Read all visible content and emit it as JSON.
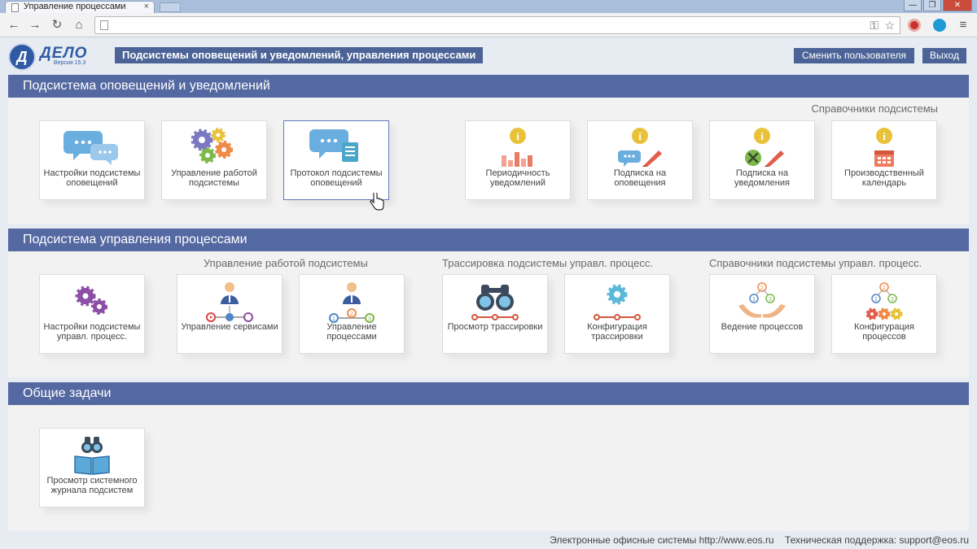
{
  "browser": {
    "tab_title": "Управление процессами",
    "tab_close": "×",
    "window_buttons": [
      "—",
      "❐",
      "✕"
    ]
  },
  "header": {
    "logo_letter": "Д",
    "logo_name": "ДЕЛО",
    "logo_version": "Версия 15.3",
    "title": "Подсистемы оповещений и уведомлений, управления процессами",
    "change_user": "Сменить пользователя",
    "logout": "Выход"
  },
  "section1": {
    "title": "Подсистема оповещений и уведомлений",
    "group_label": "Справочники подсистемы",
    "tiles": [
      {
        "label": "Настройки подсистемы оповещений",
        "icon": "chat-bubbles-icon"
      },
      {
        "label": "Управление работой подсистемы",
        "icon": "gears-icon"
      },
      {
        "label": "Протокол подсистемы оповещений",
        "icon": "chat-document-icon"
      },
      {
        "label": "Периодичность уведомлений",
        "icon": "info-chart-icon"
      },
      {
        "label": "Подписка на оповещения",
        "icon": "info-chat-pen-icon"
      },
      {
        "label": "Подписка на уведомления",
        "icon": "info-tools-pen-icon"
      },
      {
        "label": "Производственный календарь",
        "icon": "info-calendar-icon"
      }
    ]
  },
  "section2": {
    "title": "Подсистема управления процессами",
    "group_labels": [
      "Управление работой подсистемы",
      "Трассировка подсистемы управл. процесс.",
      "Справочники подсистемы управл. процесс."
    ],
    "tiles": [
      {
        "label": "Настройки подсистемы управл. процесс.",
        "icon": "purple-gears-icon"
      },
      {
        "label": "Управление сервисами",
        "icon": "user-services-icon"
      },
      {
        "label": "Управление процессами",
        "icon": "user-processes-icon"
      },
      {
        "label": "Просмотр трассировки",
        "icon": "binoculars-icon"
      },
      {
        "label": "Конфигурация трассировки",
        "icon": "gear-trace-icon"
      },
      {
        "label": "Ведение процессов",
        "icon": "hands-process-icon"
      },
      {
        "label": "Конфигурация процессов",
        "icon": "process-gears-icon"
      }
    ]
  },
  "section3": {
    "title": "Общие задачи",
    "tiles": [
      {
        "label": "Просмотр системного журнала подсистем",
        "icon": "binoculars-book-icon"
      }
    ]
  },
  "footer": {
    "company": "Электронные офисные системы http://www.eos.ru",
    "support": "Техническая поддержка: support@eos.ru"
  },
  "colors": {
    "section_header": "#5468a1",
    "accent_blue": "#2f5aa3",
    "info_yellow": "#e9c23a",
    "bubble_blue": "#6aaee0"
  }
}
